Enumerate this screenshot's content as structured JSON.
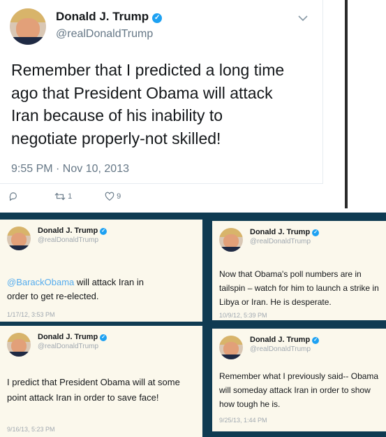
{
  "main_tweet": {
    "name": "Donald J. Trump",
    "handle": "@realDonaldTrump",
    "text": "Remember that I predicted a long time\nago that President Obama will attack\nIran because of his inability to\nnegotiate properly-not skilled!",
    "timestamp": "9:55 PM · Nov 10, 2013",
    "retweets": "1",
    "likes": "9"
  },
  "collage": [
    {
      "name": "Donald J. Trump",
      "handle": "@realDonaldTrump",
      "mention": "@BarackObama",
      "text_line1": " will attack Iran in",
      "text_rest": "order to get re-elected.",
      "timestamp": "1/17/12, 3:53 PM"
    },
    {
      "name": "Donald J. Trump",
      "handle": "@realDonaldTrump",
      "text": "Now that Obama's poll numbers are in tailspin – watch for him to launch a strike in Libya or Iran. He is desperate.",
      "timestamp": "10/9/12, 5:39 PM"
    },
    {
      "name": "Donald J. Trump",
      "handle": "@realDonaldTrump",
      "text": "I predict that President Obama will at some point attack Iran in order to save face!",
      "timestamp": "9/16/13, 5:23 PM"
    },
    {
      "name": "Donald J. Trump",
      "handle": "@realDonaldTrump",
      "text": "Remember what I previously said-- Obama will someday attack Iran in order to show how tough he is.",
      "timestamp": "9/25/13, 1:44 PM"
    }
  ],
  "colors": {
    "twitter_blue": "#1da1f2",
    "gray": "#657786",
    "collage_bg": "#0f3b52",
    "card_bg": "#fbf8ec"
  }
}
